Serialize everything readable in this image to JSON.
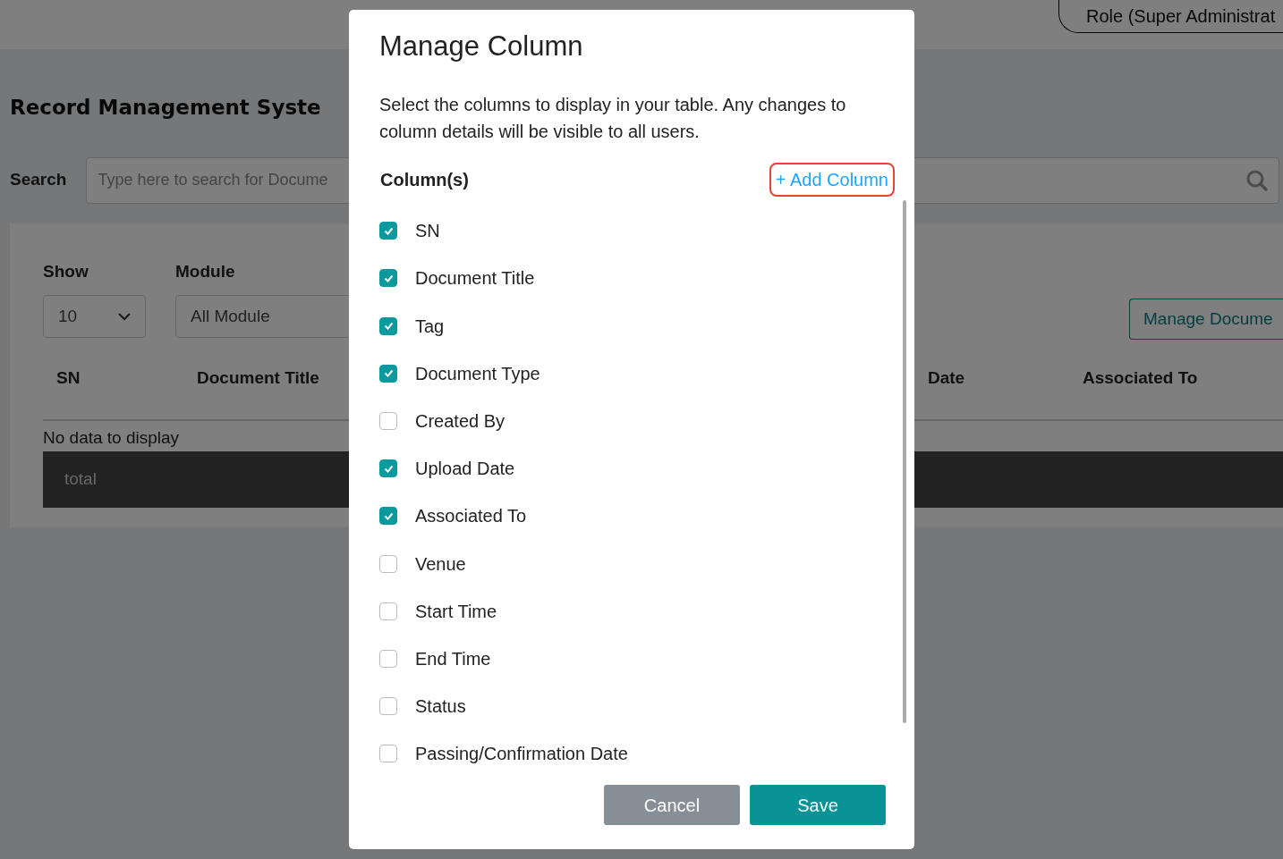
{
  "header": {
    "role_button": "Role (Super Administrat"
  },
  "page_title": "Record Management Syste",
  "search": {
    "label": "Search",
    "placeholder": "Type here to search for Docume"
  },
  "filters": [
    {
      "label": "Show",
      "value": "10",
      "kind": "select"
    },
    {
      "label": "Module",
      "value": "All Module",
      "kind": "text"
    }
  ],
  "manage_button": "Manage Docume",
  "table": {
    "columns": [
      "SN",
      "Document Title",
      "Date",
      "Associated To"
    ],
    "empty_text": "No data to display",
    "footer": "total"
  },
  "modal": {
    "title": "Manage Column",
    "description": "Select the columns to display in your table. Any changes to column details will be visible to all users.",
    "section_label": "Column(s)",
    "add_link": "+ Add Column",
    "columns": [
      {
        "label": "SN",
        "checked": true
      },
      {
        "label": "Document Title",
        "checked": true
      },
      {
        "label": "Tag",
        "checked": true
      },
      {
        "label": "Document Type",
        "checked": true
      },
      {
        "label": "Created By",
        "checked": false
      },
      {
        "label": "Upload Date",
        "checked": true
      },
      {
        "label": "Associated To",
        "checked": true
      },
      {
        "label": "Venue",
        "checked": false
      },
      {
        "label": "Start Time",
        "checked": false
      },
      {
        "label": "End Time",
        "checked": false
      },
      {
        "label": "Status",
        "checked": false
      },
      {
        "label": "Passing/Confirmation Date",
        "checked": false
      }
    ],
    "buttons": [
      {
        "label": "Cancel",
        "kind": "secondary"
      },
      {
        "label": "Save",
        "kind": "primary"
      }
    ]
  }
}
